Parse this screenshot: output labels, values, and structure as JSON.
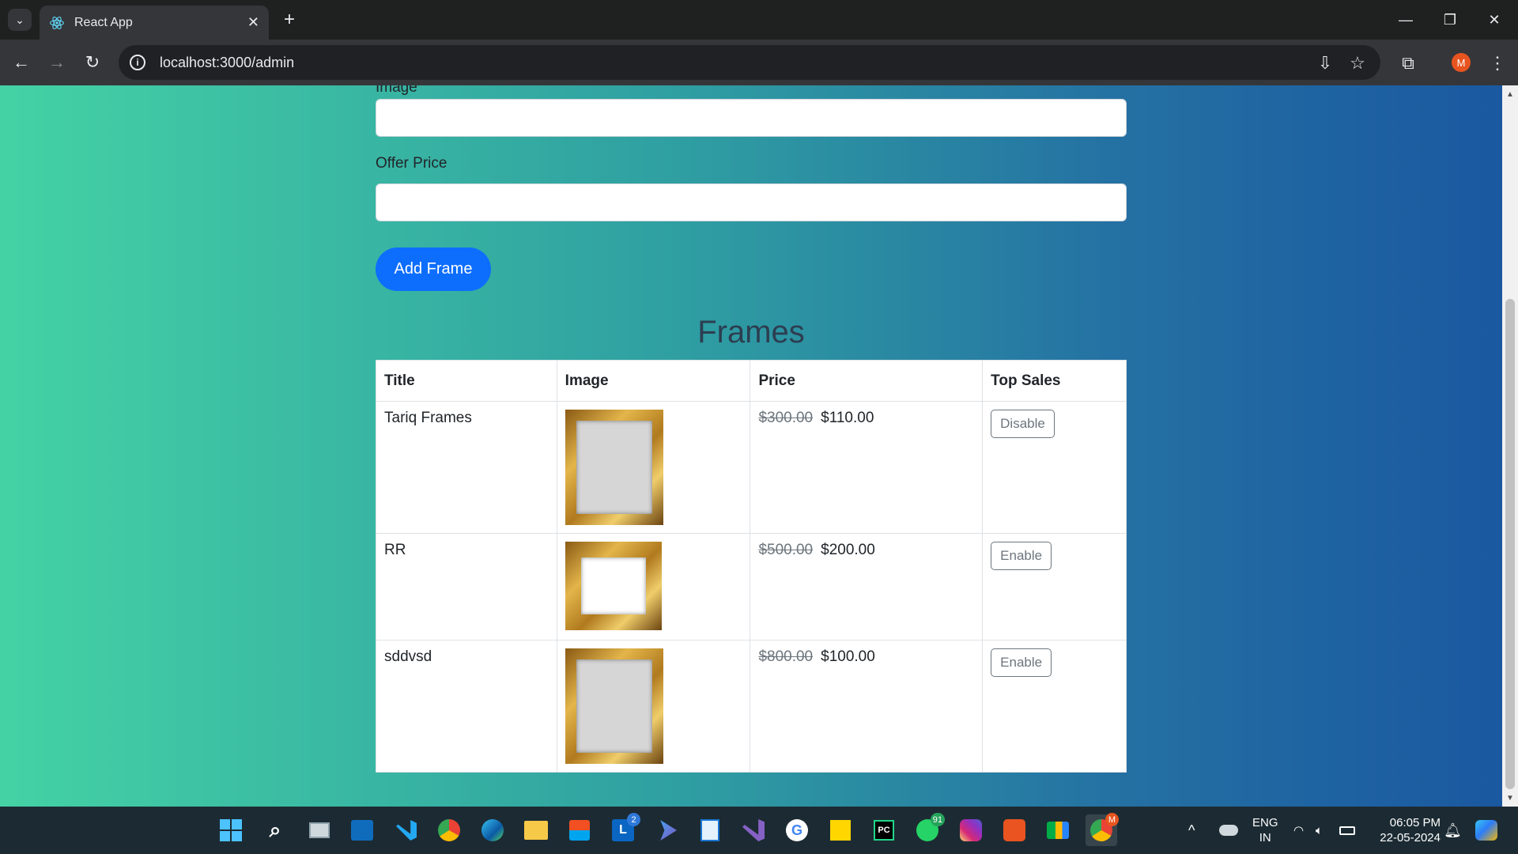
{
  "browser": {
    "tab_title": "React App",
    "url": "localhost:3000/admin",
    "profile_initial": "M"
  },
  "form": {
    "cut_label": "Image",
    "offer_price_label": "Offer Price",
    "add_button_label": "Add Frame"
  },
  "section_title": "Frames",
  "table": {
    "headers": [
      "Title",
      "Image",
      "Price",
      "Top Sales"
    ],
    "rows": [
      {
        "title": "Tariq Frames",
        "old_price": "$300.00",
        "offer_price": "$110.00",
        "action": "Disable"
      },
      {
        "title": "RR",
        "old_price": "$500.00",
        "offer_price": "$200.00",
        "action": "Enable"
      },
      {
        "title": "sddvsd",
        "old_price": "$800.00",
        "offer_price": "$100.00",
        "action": "Enable"
      }
    ]
  },
  "taskbar": {
    "language": "ENG",
    "region": "IN",
    "time": "06:05 PM",
    "date": "22-05-2024",
    "linkedin_badge": "2",
    "whatsapp_badge": "91",
    "chrome_badge": "M"
  },
  "colors": {
    "gradient_start": "#44d2a4",
    "gradient_end": "#1a58a0",
    "primary_button": "#0d6efd"
  }
}
